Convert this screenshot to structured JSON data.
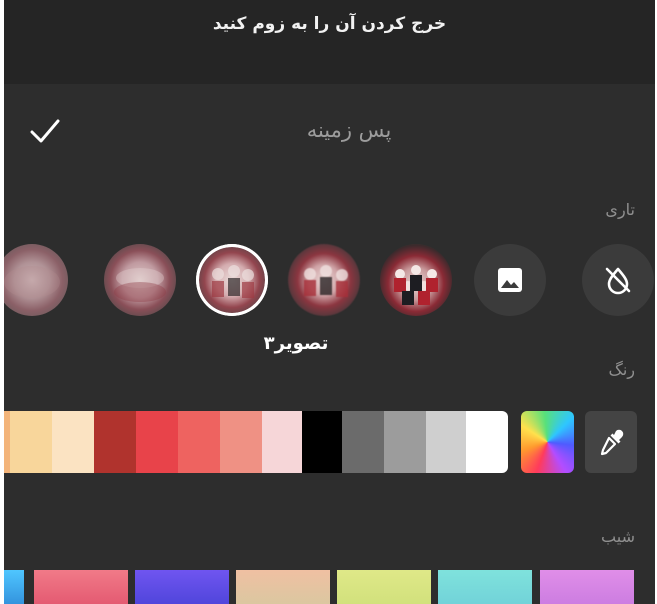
{
  "banner": {
    "text": "خرج کردن آن را به زوم کنید"
  },
  "panel": {
    "title": "پس زمینه"
  },
  "sections": {
    "blur": "تاری",
    "color": "رنگ",
    "gradient": "شیب"
  },
  "blur": {
    "selected_label": "تصویر۳",
    "options": [
      {
        "name": "none",
        "icon": "no-blur-icon"
      },
      {
        "name": "gallery",
        "icon": "image-icon"
      },
      {
        "name": "image-1"
      },
      {
        "name": "image-2"
      },
      {
        "name": "image-3",
        "selected": true
      },
      {
        "name": "image-4"
      },
      {
        "name": "image-5"
      }
    ]
  },
  "colors": {
    "swatches": [
      "#f3b47a",
      "#f8d69b",
      "#fbe3c2",
      "#b0332d",
      "#e8434a",
      "#ee6360",
      "#ef9184",
      "#f6d6d8",
      "#000000",
      "#6b6b6b",
      "#9c9c9c",
      "#cfcfcf",
      "#ffffff"
    ],
    "eyedropper_icon": "eyedropper-icon",
    "picker_icon": "color-picker-icon"
  },
  "gradients": [
    [
      "#4fc6ff",
      "#2f8bd8"
    ],
    [
      "#f17a88",
      "#e2556e"
    ],
    [
      "#6f55f0",
      "#4b43d8"
    ],
    [
      "#f0c0a2",
      "#d7c8a0"
    ],
    [
      "#dfe888",
      "#cfe07a"
    ],
    [
      "#7fe2dc",
      "#6fd0d8"
    ],
    [
      "#e08ee8",
      "#c97ae0"
    ]
  ]
}
